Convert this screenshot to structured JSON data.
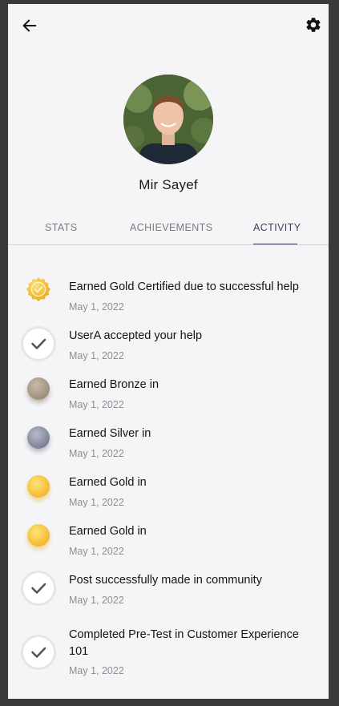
{
  "profile": {
    "name": "Mir Sayef"
  },
  "tabs": [
    {
      "label": "STATS"
    },
    {
      "label": "ACHIEVEMENTS"
    },
    {
      "label": "ACTIVITY"
    }
  ],
  "activity": [
    {
      "title": "Earned Gold Certified due to successful help",
      "date": "May 1, 2022",
      "icon": "gold-certified-badge-icon"
    },
    {
      "title": "UserA accepted your help",
      "date": "May 1, 2022",
      "icon": "checkmark-icon"
    },
    {
      "title": "Earned Bronze in",
      "date": "May 1, 2022",
      "icon": "bronze-medal-icon"
    },
    {
      "title": "Earned Silver in",
      "date": "May 1, 2022",
      "icon": "silver-medal-icon"
    },
    {
      "title": "Earned Gold in",
      "date": "May 1, 2022",
      "icon": "gold-medal-icon"
    },
    {
      "title": "Earned Gold in",
      "date": "May 1, 2022",
      "icon": "gold-medal-icon"
    },
    {
      "title": "Post successfully made in community",
      "date": "May 1, 2022",
      "icon": "checkmark-icon"
    },
    {
      "title": "Completed Pre-Test in Customer Experience 101",
      "date": "May 1, 2022",
      "icon": "checkmark-icon"
    }
  ],
  "colors": {
    "accent": "#3e3d5a",
    "gold": "#f2b81e",
    "bronze": "#9a8a76",
    "silver": "#7c8194"
  }
}
